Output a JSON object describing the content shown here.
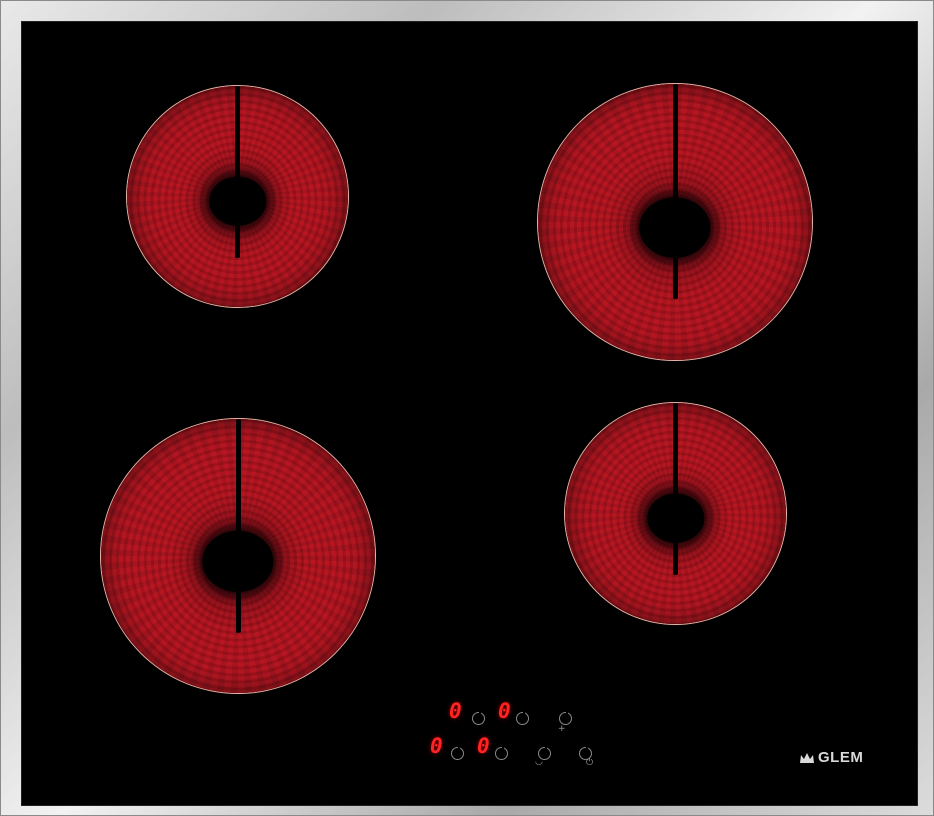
{
  "hob": {
    "brand": "GLEM",
    "cooking_zones": [
      {
        "name": "rear-left"
      },
      {
        "name": "rear-right"
      },
      {
        "name": "front-left"
      },
      {
        "name": "front-right"
      }
    ],
    "controls": {
      "displays": [
        "0",
        "0",
        "0",
        "0"
      ],
      "icons": [
        "power-icon",
        "timer-icon",
        "plus-icon",
        "minus-icon"
      ]
    },
    "colors": {
      "glass": "#000000",
      "zone_red": "#b4141f",
      "display_red": "#ff2323",
      "frame": "#c8c8c8"
    }
  }
}
